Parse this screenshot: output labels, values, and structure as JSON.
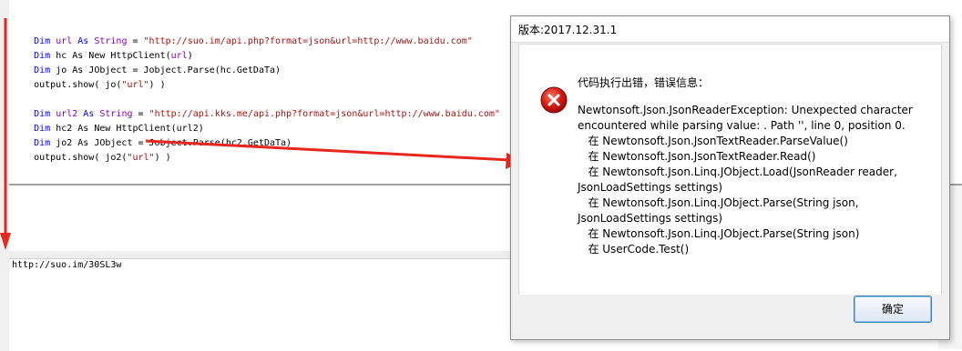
{
  "editor": {
    "lines": [
      {
        "k1": "Dim ",
        "v": "url",
        "k2": " As ",
        "t": "String",
        "rest": " = ",
        "s": "\"http://suo.im/api.php?format=json&url=http://www.baidu.com\""
      },
      {
        "k1": "Dim ",
        "plain": "hc As New HttpClient(",
        "v": "url",
        "tail": ")"
      },
      {
        "k1": "Dim ",
        "plain": "jo As JObject = Jobject.Parse(hc.GetDaTa)"
      },
      {
        "plain": "output.show( jo(",
        "s": "\"url\"",
        "tail": ") )"
      },
      {
        "k1": "Dim ",
        "v": "url2",
        "k2": " As ",
        "t": "String",
        "rest": " = ",
        "s": "\"http://api.kks.me/api.php?format=json&url=http://www.baidu.com\""
      },
      {
        "k1": "Dim ",
        "plain": "hc2 As New HttpClient(url2)"
      },
      {
        "k1": "Dim ",
        "plain": "jo2 As JObject = Jobject.Parse(hc2.GetDaTa)"
      },
      {
        "plain": "output.show( jo2(",
        "s": "\"url\"",
        "tail": ") )"
      }
    ]
  },
  "output": {
    "text": "http://suo.im/30SL3w"
  },
  "dialog": {
    "title": "版本:2017.12.31.1",
    "heading": "代码执行出错，错误信息：",
    "message": "Newtonsoft.Json.JsonReaderException: Unexpected character\nencountered while parsing value: . Path '', line 0, position 0.\n   在 Newtonsoft.Json.JsonTextReader.ParseValue()\n   在 Newtonsoft.Json.JsonTextReader.Read()\n   在 Newtonsoft.Json.Linq.JObject.Load(JsonReader reader,\nJsonLoadSettings settings)\n   在 Newtonsoft.Json.Linq.JObject.Parse(String json,\nJsonLoadSettings settings)\n   在 Newtonsoft.Json.Linq.JObject.Parse(String json)\n   在 UserCode.Test()",
    "ok_label": "确定",
    "icon": "error-icon"
  },
  "colors": {
    "keyword": "#0000ff",
    "string": "#a31515",
    "type": "#8b00c0",
    "arrow": "#e8261c"
  }
}
